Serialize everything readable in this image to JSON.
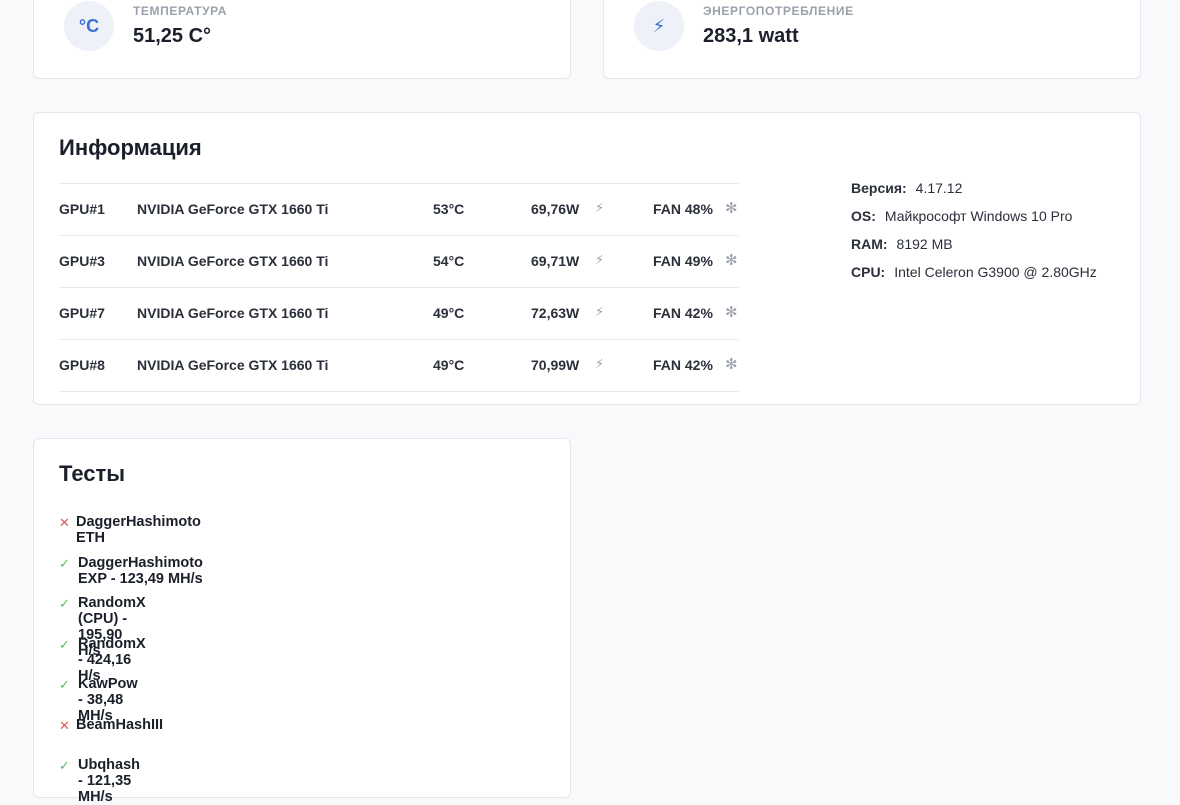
{
  "stats": [
    {
      "label": "ТЕМПЕРАТУРА",
      "value": "51,25 C°",
      "icon": "celsius-icon",
      "icon_glyph": "°C"
    },
    {
      "label": "ЭНЕРГОПОТРЕБЛЕНИЕ",
      "value": "283,1 watt",
      "icon": "lightning-icon",
      "icon_glyph": "⚡"
    }
  ],
  "info": {
    "title": "Информация",
    "gpus": [
      {
        "id": "GPU#1",
        "name": "NVIDIA GeForce GTX 1660 Ti",
        "temp": "53°C",
        "power": "69,76W",
        "fan": "FAN 48%"
      },
      {
        "id": "GPU#3",
        "name": "NVIDIA GeForce GTX 1660 Ti",
        "temp": "54°C",
        "power": "69,71W",
        "fan": "FAN 49%"
      },
      {
        "id": "GPU#7",
        "name": "NVIDIA GeForce GTX 1660 Ti",
        "temp": "49°C",
        "power": "72,63W",
        "fan": "FAN 42%"
      },
      {
        "id": "GPU#8",
        "name": "NVIDIA GeForce GTX 1660 Ti",
        "temp": "49°C",
        "power": "70,99W",
        "fan": "FAN 42%"
      }
    ],
    "system": [
      {
        "key": "Версия:",
        "value": "4.17.12"
      },
      {
        "key": "OS:",
        "value": "Майкрософт Windows 10 Pro"
      },
      {
        "key": "RAM:",
        "value": "8192 MB"
      },
      {
        "key": "CPU:",
        "value": "Intel Celeron G3900 @ 2.80GHz"
      }
    ]
  },
  "tests": {
    "title": "Тесты",
    "items": [
      {
        "label": "DaggerHashimoto ETH",
        "status": "fail"
      },
      {
        "label": "DaggerHashimoto EXP - 123,49 MH/s",
        "status": "ok"
      },
      {
        "label": "RandomX (CPU) - 195,90 H/s",
        "status": "ok"
      },
      {
        "label": "RandomX - 424,16 H/s",
        "status": "ok"
      },
      {
        "label": "KawPow - 38,48 MH/s",
        "status": "ok"
      },
      {
        "label": "BeamHashIII",
        "status": "fail"
      },
      {
        "label": "Ubqhash - 121,35 MH/s",
        "status": "ok"
      }
    ]
  },
  "colors": {
    "accent": "#3b6fd6",
    "ok": "#5cb85c",
    "fail": "#e25b5b",
    "muted": "#9aa1ad"
  }
}
